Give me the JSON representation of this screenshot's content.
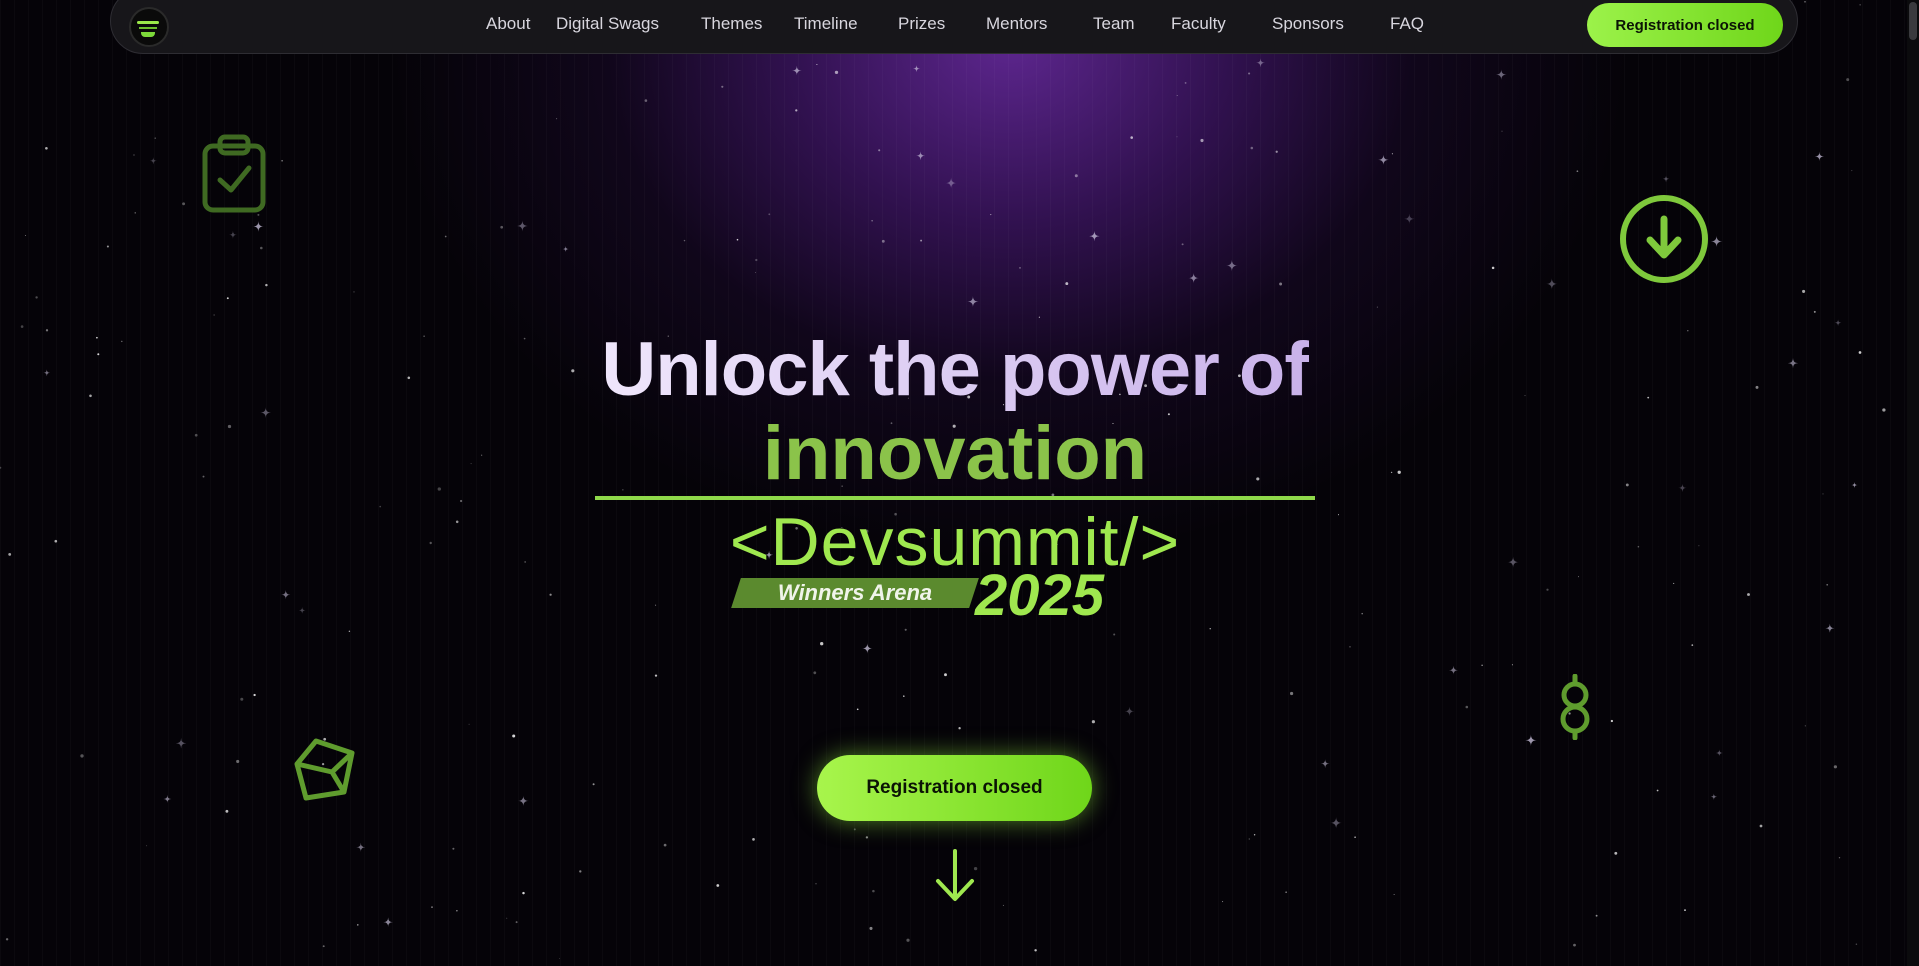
{
  "nav": {
    "links": [
      "About",
      "Digital Swags",
      "Themes",
      "Timeline",
      "Prizes",
      "Mentors",
      "Team",
      "Faculty",
      "Sponsors",
      "FAQ"
    ],
    "cta_label": "Registration closed"
  },
  "hero": {
    "line1": "Unlock the power of",
    "line2": "innovation",
    "event": "<Devsummit/>",
    "badge": "Winners Arena",
    "year": "2025",
    "cta_label": "Registration closed"
  },
  "colors": {
    "accent_green": "#9fe84f",
    "title_green": "#8bc34a",
    "purple_glow": "#622896",
    "background": "#050308"
  },
  "icons": [
    "clipboard-check-icon",
    "arrow-down-circle-icon",
    "cube-icon",
    "eight-icon",
    "arrow-down-icon",
    "logo-icon"
  ]
}
